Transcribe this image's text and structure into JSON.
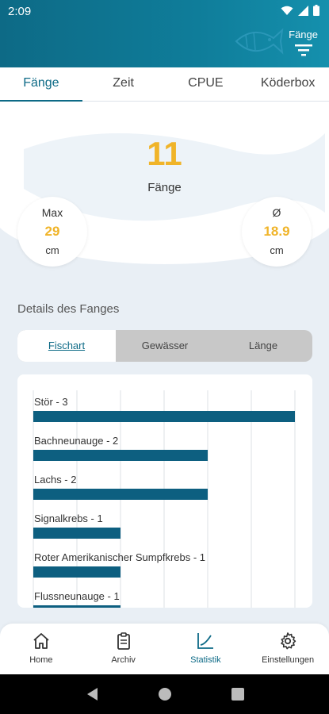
{
  "status": {
    "time": "2:09"
  },
  "header": {
    "filter_label": "Fänge"
  },
  "tabs": [
    {
      "label": "Fänge",
      "active": true
    },
    {
      "label": "Zeit",
      "active": false
    },
    {
      "label": "CPUE",
      "active": false
    },
    {
      "label": "Köderbox",
      "active": false
    }
  ],
  "summary": {
    "count": "11",
    "count_label": "Fänge",
    "max": {
      "title": "Max",
      "value": "29",
      "unit": "cm"
    },
    "avg": {
      "title": "Ø",
      "value": "18.9",
      "unit": "cm"
    }
  },
  "details": {
    "title": "Details des Fanges",
    "segments": [
      "Fischart",
      "Gewässer",
      "Länge"
    ],
    "active_segment": "Fischart"
  },
  "chart_data": {
    "type": "bar",
    "orientation": "horizontal",
    "labels": [
      "Stör - 3",
      "Bachneunauge - 2",
      "Lachs - 2",
      "Signalkrebs - 1",
      "Roter Amerikanischer Sumpfkrebs - 1",
      "Flussneunauge - 1"
    ],
    "categories": [
      "Stör",
      "Bachneunauge",
      "Lachs",
      "Signalkrebs",
      "Roter Amerikanischer Sumpfkrebs",
      "Flussneunauge"
    ],
    "values": [
      3,
      2,
      2,
      1,
      1,
      1
    ],
    "xlim": [
      0,
      3
    ],
    "grid": true,
    "bar_color": "#0d5f80"
  },
  "nav": [
    {
      "label": "Home",
      "icon": "home-icon",
      "active": false
    },
    {
      "label": "Archiv",
      "icon": "clipboard-icon",
      "active": false
    },
    {
      "label": "Statistik",
      "icon": "chart-line-icon",
      "active": true
    },
    {
      "label": "Einstellungen",
      "icon": "gear-icon",
      "active": false
    }
  ],
  "colors": {
    "primary": "#0d6a86",
    "accent": "#f0b429",
    "background": "#e9eff5"
  }
}
